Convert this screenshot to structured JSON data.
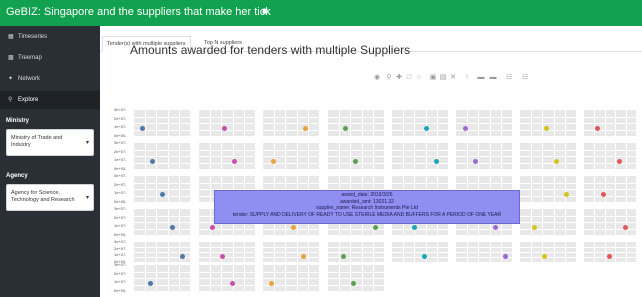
{
  "app": {
    "title": "GeBIZ: Singapore and the suppliers that make her tick",
    "menu_icon": "hamburger-icon"
  },
  "sidebar": {
    "items": [
      {
        "label": "Timeseries",
        "icon": "calendar-icon"
      },
      {
        "label": "Treemap",
        "icon": "grid-icon"
      },
      {
        "label": "Network",
        "icon": "share-icon"
      },
      {
        "label": "Explore",
        "icon": "search-icon"
      }
    ],
    "ministry": {
      "label": "Ministry",
      "value": "Ministry of Trade and Industry"
    },
    "agency": {
      "label": "Agency",
      "value": "Agency for Science, Technology and Research"
    }
  },
  "tabs": [
    {
      "label": "Tender(s) with multiple suppliers",
      "active": true
    },
    {
      "label": "Top N suppliers",
      "active": false
    }
  ],
  "plot": {
    "title": "Amounts awarded for tenders with multiple Suppliers",
    "y_ticks": [
      "3e+07-",
      "2e+07-",
      "1e+07-",
      "0e+00-"
    ],
    "modebar_icons": [
      "camera-icon",
      "zoom-icon",
      "pan-icon",
      "zoom-in-icon",
      "zoom-out-icon",
      "autoscale-icon",
      "reset-axes-icon",
      "spike-lines-icon",
      "hover-closest-icon",
      "hover-compare-icon",
      "plotly-logo-icon"
    ]
  },
  "tooltip": {
    "award_date": "award_date: 2019/3/26",
    "awarded_amt": "awarded_amt: 13021.32",
    "supplier_name": "supplier_name: Research Instruments Pte Ltd",
    "tender": "tender: SUPPLY AND DELIVERY OF READY TO USE STERILE MEDIA AND BUFFERS FOR A PERIOD OF ONE YEAR"
  },
  "colors": {
    "header": "#12a24f",
    "sidebar": "#2a2f36",
    "panel": "#e8e8e8",
    "tooltip": "#8f8ff2",
    "points": [
      "#4e79a7",
      "#c94fa8",
      "#e8a33b",
      "#59a14f",
      "#1aa6b7",
      "#9b6bd1",
      "#d4c21f",
      "#e15759"
    ]
  }
}
